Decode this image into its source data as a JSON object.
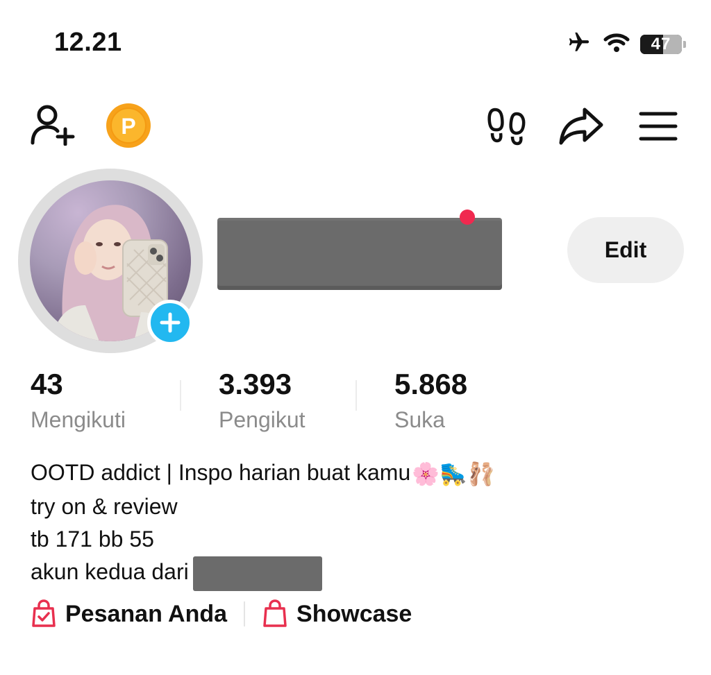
{
  "status_bar": {
    "time": "12.21",
    "battery": "47",
    "icons": [
      "airplane-icon",
      "wifi-icon",
      "battery-icon"
    ]
  },
  "toolbar": {
    "left_icons": [
      "add-friend-icon",
      "coin-p-icon"
    ],
    "coin_letter": "P",
    "right_icons": [
      "footprint-icon",
      "share-icon",
      "menu-icon"
    ]
  },
  "profile": {
    "edit_label": "Edit"
  },
  "stats": [
    {
      "value": "43",
      "label": "Mengikuti"
    },
    {
      "value": "3.393",
      "label": "Pengikut"
    },
    {
      "value": "5.868",
      "label": "Suka"
    }
  ],
  "bio": {
    "line1": "OOTD addict | Inspo harian buat kamu",
    "line1_emoji": "🌸🛼🩰",
    "line2": "try on & review",
    "line3": "tb 171 bb 55",
    "line4": "akun kedua dari"
  },
  "links": {
    "orders": "Pesanan Anda",
    "showcase": "Showcase"
  },
  "colors": {
    "accent_pink": "#e8304f",
    "coin_orange": "#f7a21b",
    "plus_blue": "#22b8f0",
    "muted_text": "#8b8b8b"
  }
}
